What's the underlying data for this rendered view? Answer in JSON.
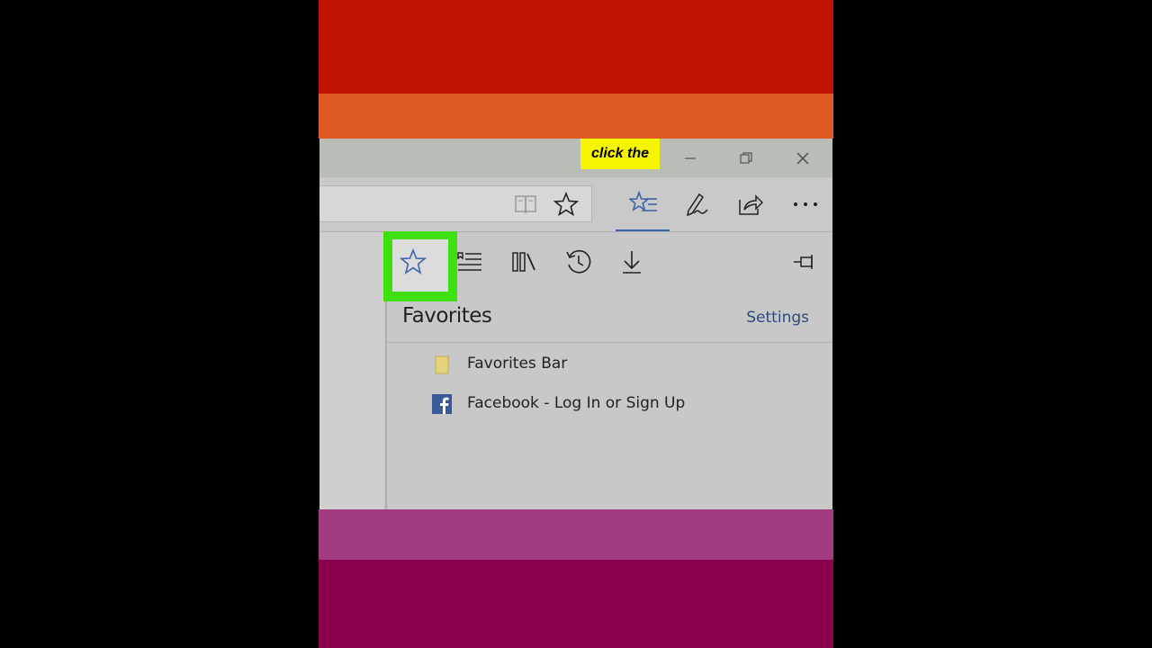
{
  "caption": {
    "text": "click the"
  },
  "window_controls": {
    "minimize": "minimize-icon",
    "restore": "restore-icon",
    "close": "close-icon"
  },
  "toolbar": {
    "icons": [
      "reading-view-icon",
      "add-favorite-star-icon",
      "hub-icon",
      "web-note-pen-icon",
      "share-icon",
      "more-icon"
    ],
    "hub_active_color": "#3e64a8"
  },
  "hub_pane": {
    "tabs": [
      "favorites-star-icon",
      "reading-list-icon",
      "books-icon",
      "history-icon",
      "downloads-icon"
    ],
    "pin_icon": "pin-icon",
    "title": "Favorites",
    "settings_label": "Settings",
    "items": [
      {
        "label": "Favorites Bar",
        "icon": "folder-icon"
      },
      {
        "label": "Facebook - Log In or Sign Up",
        "icon": "facebook-icon"
      }
    ],
    "highlight_color": "#3ee10f"
  }
}
